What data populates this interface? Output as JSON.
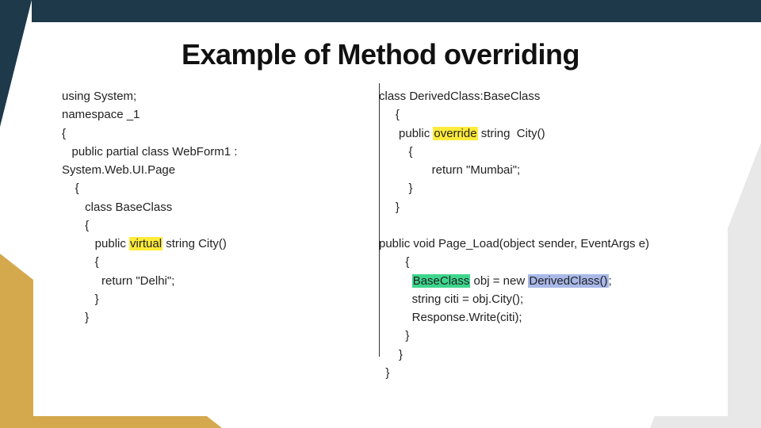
{
  "title": "Example of Method overriding",
  "left": {
    "l1": "using System;",
    "l2": "namespace _1",
    "l3": "{",
    "l4": "   public partial class WebForm1 :",
    "l5": "System.Web.UI.Page",
    "l6": "    {",
    "l7": "       class BaseClass",
    "l8": "       {",
    "l9a": "          public ",
    "l9hl": "virtual",
    "l9b": " string City()",
    "l10": "          {",
    "l11": "            return \"Delhi\";",
    "l12": "          }",
    "l13": "       }"
  },
  "right": {
    "l1": "class DerivedClass:BaseClass",
    "l2": "     {",
    "l3a": "      public ",
    "l3hl": "override",
    "l3b": " string  City()",
    "l4": "         {",
    "l5": "                return \"Mumbai\";",
    "l6": "         }",
    "l7": "     }",
    "l8": "",
    "l9": "public void Page_Load(object sender, EventArgs e)",
    "l10": "        {",
    "l11a": "          ",
    "l11hl1": "BaseClass",
    "l11b": " obj = new ",
    "l11hl2": "DerivedClass()",
    "l11c": ";",
    "l12": "          string citi = obj.City();",
    "l13": "          Response.Write(citi);",
    "l14": "        }",
    "l15": "      }",
    "l16": "  }"
  }
}
